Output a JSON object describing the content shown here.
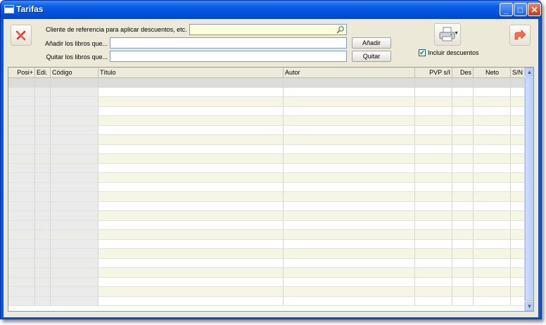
{
  "window": {
    "title": "Tarifas"
  },
  "toolbar": {
    "cancel_icon": "x-icon",
    "print_icon": "printer-icon",
    "exit_icon": "exit-arrow-icon",
    "cliente_label": "Cliente de referencia para aplicar descuentos, etc.",
    "cliente_value": "",
    "anadir_label": "Añadir los libros que...",
    "anadir_value": "",
    "anadir_button": "Añadir",
    "quitar_label": "Quitar los libros que...",
    "quitar_value": "",
    "quitar_button": "Quitar",
    "incluir_descuentos_label": "Incluir descuentos",
    "incluir_descuentos_checked": true
  },
  "table": {
    "columns": [
      "Posi+",
      "Edi.",
      "Código",
      "Título",
      "Autor",
      "PVP s/I",
      "Des",
      "Neto",
      "S/N"
    ],
    "rows": []
  }
}
